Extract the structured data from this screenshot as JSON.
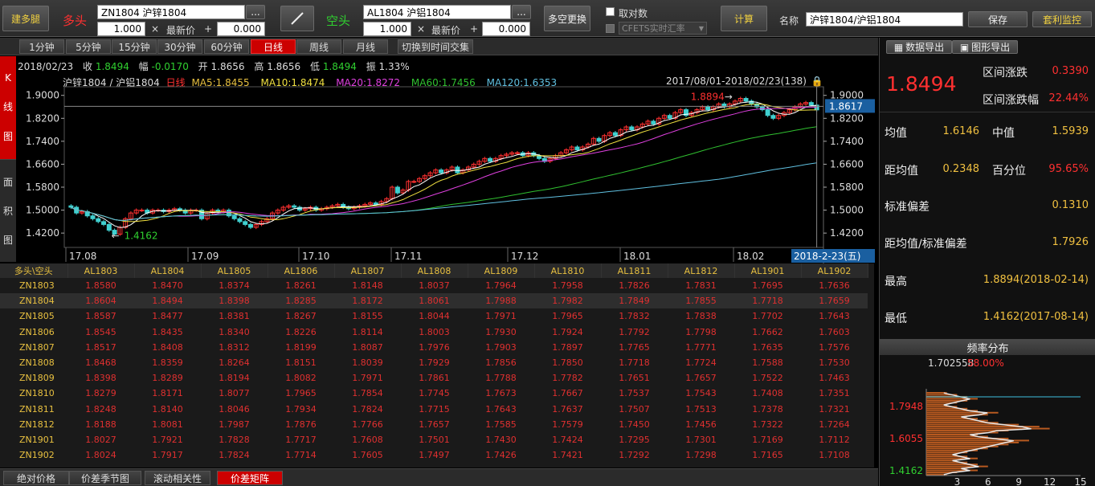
{
  "toolbar": {
    "build_leg": "建多腿",
    "long_label": "多头",
    "long_contract": "ZN1804  沪锌1804",
    "long_qty": "1.000",
    "long_price_label": "最新价",
    "long_offset": "0.000",
    "short_label": "空头",
    "short_contract": "AL1804  沪铝1804",
    "short_qty": "1.000",
    "short_price_label": "最新价",
    "short_offset": "0.000",
    "swap": "多空更换",
    "reciprocal": "取对数",
    "cfets": "CFETS实时汇率",
    "calc": "计算",
    "name_label": "名称",
    "name_value": "沪锌1804/沪铝1804",
    "save": "保存",
    "monitor": "套利监控",
    "dots": "...",
    "times": "×",
    "plus": "+"
  },
  "periods": [
    "1分钟",
    "5分钟",
    "15分钟",
    "30分钟",
    "60分钟",
    "日线",
    "周线",
    "月线"
  ],
  "active_period": 5,
  "switch_btn": "切换到时间交集",
  "vtabs": {
    "kline": [
      "K",
      "线",
      "图"
    ],
    "area": [
      "面",
      "积",
      "图"
    ]
  },
  "quote": {
    "date": "2018/02/23",
    "close_label": "收",
    "close": "1.8494",
    "chg_label": "幅",
    "chg": "-0.0170",
    "open_label": "开",
    "open": "1.8656",
    "high_label": "高",
    "high": "1.8656",
    "low_label": "低",
    "low": "1.8494",
    "amp_label": "振",
    "amp": "1.33%"
  },
  "ma": {
    "name": "沪锌1804 / 沪铝1804",
    "period": "日线",
    "ma5": "MA5:1.8455",
    "ma10": "MA10:1.8474",
    "ma20": "MA20:1.8272",
    "ma60": "MA60:1.7456",
    "ma120": "MA120:1.6353",
    "range": "2017/08/01-2018/02/23(138)"
  },
  "chart_data": {
    "type": "candlestick",
    "yticks": [
      "1.9000",
      "1.8200",
      "1.7400",
      "1.6600",
      "1.5800",
      "1.5000",
      "1.4200"
    ],
    "yvals": [
      1.9,
      1.82,
      1.74,
      1.66,
      1.58,
      1.5,
      1.42
    ],
    "xticks": [
      "17.08",
      "17.09",
      "17.10",
      "17.11",
      "17.12",
      "18.01",
      "18.02"
    ],
    "last_price_tag": "1.8617",
    "last_date_tag": "2018-2-23(五)",
    "high_marker": "1.8894",
    "low_marker": "1.4162",
    "series": [
      {
        "name": "MA5",
        "color": "#ffffff"
      },
      {
        "name": "MA10",
        "color": "#f0e040"
      },
      {
        "name": "MA20",
        "color": "#e040e0"
      },
      {
        "name": "MA60",
        "color": "#30c030"
      },
      {
        "name": "MA120",
        "color": "#60c0e0"
      }
    ],
    "close": [
      1.51,
      1.49,
      1.495,
      1.48,
      1.47,
      1.46,
      1.45,
      1.43,
      1.4162,
      1.44,
      1.47,
      1.49,
      1.5,
      1.5,
      1.49,
      1.5,
      1.5,
      1.495,
      1.5,
      1.505,
      1.5,
      1.49,
      1.5,
      1.5,
      1.47,
      1.49,
      1.5,
      1.495,
      1.5,
      1.48,
      1.47,
      1.46,
      1.45,
      1.44,
      1.45,
      1.46,
      1.47,
      1.49,
      1.5,
      1.51,
      1.515,
      1.51,
      1.5,
      1.505,
      1.51,
      1.5,
      1.505,
      1.51,
      1.515,
      1.52,
      1.51,
      1.505,
      1.51,
      1.515,
      1.52,
      1.525,
      1.52,
      1.53,
      1.54,
      1.58,
      1.56,
      1.57,
      1.6,
      1.6,
      1.61,
      1.62,
      1.63,
      1.64,
      1.63,
      1.64,
      1.65,
      1.63,
      1.64,
      1.65,
      1.66,
      1.67,
      1.68,
      1.67,
      1.68,
      1.69,
      1.695,
      1.7,
      1.7,
      1.69,
      1.7,
      1.69,
      1.68,
      1.67,
      1.68,
      1.69,
      1.7,
      1.71,
      1.72,
      1.71,
      1.72,
      1.73,
      1.75,
      1.74,
      1.76,
      1.77,
      1.76,
      1.78,
      1.79,
      1.78,
      1.79,
      1.8,
      1.81,
      1.8,
      1.82,
      1.83,
      1.82,
      1.84,
      1.85,
      1.83,
      1.84,
      1.85,
      1.86,
      1.85,
      1.86,
      1.87,
      1.86,
      1.87,
      1.88,
      1.8894,
      1.88,
      1.87,
      1.86,
      1.85,
      1.83,
      1.82,
      1.83,
      1.84,
      1.85,
      1.86,
      1.87,
      1.875,
      1.866,
      1.8494
    ]
  },
  "matrix": {
    "corner": "多头\\空头",
    "cols": [
      "AL1803",
      "AL1804",
      "AL1805",
      "AL1806",
      "AL1807",
      "AL1808",
      "AL1809",
      "AL1810",
      "AL1811",
      "AL1812",
      "AL1901",
      "AL1902"
    ],
    "rows": [
      {
        "name": "ZN1803",
        "vals": [
          "1.8580",
          "1.8470",
          "1.8374",
          "1.8261",
          "1.8148",
          "1.8037",
          "1.7964",
          "1.7958",
          "1.7826",
          "1.7831",
          "1.7695",
          "1.7636"
        ]
      },
      {
        "name": "ZN1804",
        "vals": [
          "1.8604",
          "1.8494",
          "1.8398",
          "1.8285",
          "1.8172",
          "1.8061",
          "1.7988",
          "1.7982",
          "1.7849",
          "1.7855",
          "1.7718",
          "1.7659"
        ]
      },
      {
        "name": "ZN1805",
        "vals": [
          "1.8587",
          "1.8477",
          "1.8381",
          "1.8267",
          "1.8155",
          "1.8044",
          "1.7971",
          "1.7965",
          "1.7832",
          "1.7838",
          "1.7702",
          "1.7643"
        ]
      },
      {
        "name": "ZN1806",
        "vals": [
          "1.8545",
          "1.8435",
          "1.8340",
          "1.8226",
          "1.8114",
          "1.8003",
          "1.7930",
          "1.7924",
          "1.7792",
          "1.7798",
          "1.7662",
          "1.7603"
        ]
      },
      {
        "name": "ZN1807",
        "vals": [
          "1.8517",
          "1.8408",
          "1.8312",
          "1.8199",
          "1.8087",
          "1.7976",
          "1.7903",
          "1.7897",
          "1.7765",
          "1.7771",
          "1.7635",
          "1.7576"
        ]
      },
      {
        "name": "ZN1808",
        "vals": [
          "1.8468",
          "1.8359",
          "1.8264",
          "1.8151",
          "1.8039",
          "1.7929",
          "1.7856",
          "1.7850",
          "1.7718",
          "1.7724",
          "1.7588",
          "1.7530"
        ]
      },
      {
        "name": "ZN1809",
        "vals": [
          "1.8398",
          "1.8289",
          "1.8194",
          "1.8082",
          "1.7971",
          "1.7861",
          "1.7788",
          "1.7782",
          "1.7651",
          "1.7657",
          "1.7522",
          "1.7463"
        ]
      },
      {
        "name": "ZN1810",
        "vals": [
          "1.8279",
          "1.8171",
          "1.8077",
          "1.7965",
          "1.7854",
          "1.7745",
          "1.7673",
          "1.7667",
          "1.7537",
          "1.7543",
          "1.7408",
          "1.7351"
        ]
      },
      {
        "name": "ZN1811",
        "vals": [
          "1.8248",
          "1.8140",
          "1.8046",
          "1.7934",
          "1.7824",
          "1.7715",
          "1.7643",
          "1.7637",
          "1.7507",
          "1.7513",
          "1.7378",
          "1.7321"
        ]
      },
      {
        "name": "ZN1812",
        "vals": [
          "1.8188",
          "1.8081",
          "1.7987",
          "1.7876",
          "1.7766",
          "1.7657",
          "1.7585",
          "1.7579",
          "1.7450",
          "1.7456",
          "1.7322",
          "1.7264"
        ]
      },
      {
        "name": "ZN1901",
        "vals": [
          "1.8027",
          "1.7921",
          "1.7828",
          "1.7717",
          "1.7608",
          "1.7501",
          "1.7430",
          "1.7424",
          "1.7295",
          "1.7301",
          "1.7169",
          "1.7112"
        ]
      },
      {
        "name": "ZN1902",
        "vals": [
          "1.8024",
          "1.7917",
          "1.7824",
          "1.7714",
          "1.7605",
          "1.7497",
          "1.7426",
          "1.7421",
          "1.7292",
          "1.7298",
          "1.7165",
          "1.7108"
        ]
      }
    ]
  },
  "bottom_tabs": [
    "绝对价格",
    "价差季节图",
    "滚动相关性",
    "价差矩阵"
  ],
  "active_bottom": 3,
  "right": {
    "export_data": "数据导出",
    "export_image": "图形导出",
    "price": "1.8494",
    "range_chg_label": "区间涨跌",
    "range_chg": "0.3390",
    "range_pct_label": "区间涨跌幅",
    "range_pct": "22.44%",
    "mean_label": "均值",
    "mean": "1.6146",
    "median_label": "中值",
    "median": "1.5939",
    "dist_label": "距均值",
    "dist": "0.2348",
    "pct_label": "百分位",
    "pct": "95.65%",
    "std_label": "标准偏差",
    "std": "0.1310",
    "dist_std_label": "距均值/标准偏差",
    "dist_std": "1.7926",
    "high_label": "最高",
    "high": "1.8894(2018-02-14)",
    "low_label": "最低",
    "low": "1.4162(2017-08-14)",
    "freq_title": "频率分布",
    "freq_cursor_val": "1.702558",
    "freq_cursor_pct": "58.00%",
    "freq_yticks": [
      "1.7948",
      "1.6055",
      "1.4162"
    ],
    "freq_xticks": [
      "3",
      "6",
      "9",
      "12",
      "15"
    ],
    "freq_bins": [
      2,
      3,
      5,
      4,
      6,
      5,
      4,
      3,
      5,
      4,
      3,
      4,
      5,
      6,
      7,
      8,
      9,
      10,
      8,
      6,
      5,
      7,
      8,
      12,
      11,
      9,
      7,
      6,
      5,
      4,
      6,
      7,
      5,
      4,
      3,
      2,
      3,
      4,
      5,
      4,
      3,
      2
    ]
  }
}
